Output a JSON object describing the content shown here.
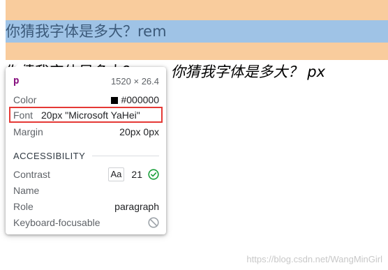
{
  "page": {
    "highlight_text": "你猜我字体是多大？rem",
    "line_text_plain": "你猜我字体是多大？rem",
    "line_text_italic": "你猜我字体是多大？ px"
  },
  "tooltip": {
    "tag": "p",
    "dimensions": "1520 × 26.4",
    "rows": {
      "color_label": "Color",
      "color_value": "#000000",
      "font_label": "Font",
      "font_value": "20px \"Microsoft YaHei\"",
      "margin_label": "Margin",
      "margin_value": "20px 0px"
    },
    "accessibility": {
      "heading": "ACCESSIBILITY",
      "contrast_label": "Contrast",
      "contrast_sample": "Aa",
      "contrast_value": "21",
      "name_label": "Name",
      "name_value": "",
      "role_label": "Role",
      "role_value": "paragraph",
      "keyboard_label": "Keyboard-focusable"
    },
    "icons": {
      "contrast_status": "check-circle-icon",
      "keyboard_status": "not-allowed-icon"
    }
  },
  "watermark": "https://blog.csdn.net/WangMinGirl",
  "colors": {
    "margin_overlay": "#f9cc9d",
    "content_overlay": "#9fc3e6",
    "tag_color": "#881280",
    "highlight_border": "#e53935",
    "check_green": "#1a9f3b",
    "swatch": "#000000"
  }
}
